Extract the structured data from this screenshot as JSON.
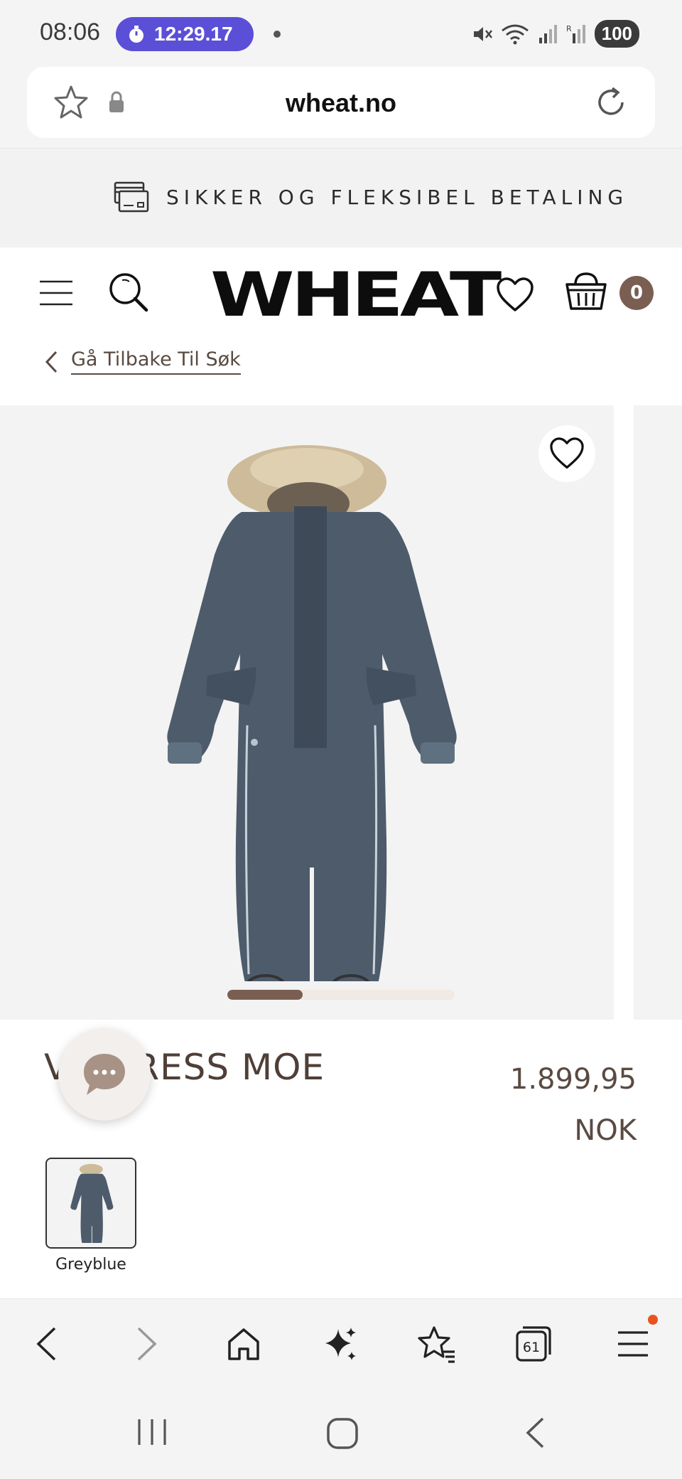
{
  "status_bar": {
    "time": "08:06",
    "timer": "12:29.17",
    "battery": "100"
  },
  "browser": {
    "url": "wheat.no",
    "nav_buttons": [
      "back-icon",
      "forward-icon",
      "home-icon",
      "ai-sparkle-icon",
      "bookmarks-icon",
      "tabs-icon",
      "menu-icon"
    ],
    "tabs_count": "61"
  },
  "banner": {
    "text": "SIKKER OG FLEKSIBEL BETALING"
  },
  "header": {
    "logo": "WHEAT",
    "cart_count": "0",
    "back_link": "Gå Tilbake Til Søk"
  },
  "gallery": {
    "pager_progress": 0.33
  },
  "product": {
    "title": "V     RDRESS MOE",
    "price_amount": "1.899,95",
    "price_currency": "NOK",
    "swatches": [
      {
        "label": "Greyblue"
      }
    ]
  },
  "colors": {
    "accent": "#7a5e52",
    "timer_pill": "#5b4fd8",
    "notification_dot": "#e8541c"
  }
}
